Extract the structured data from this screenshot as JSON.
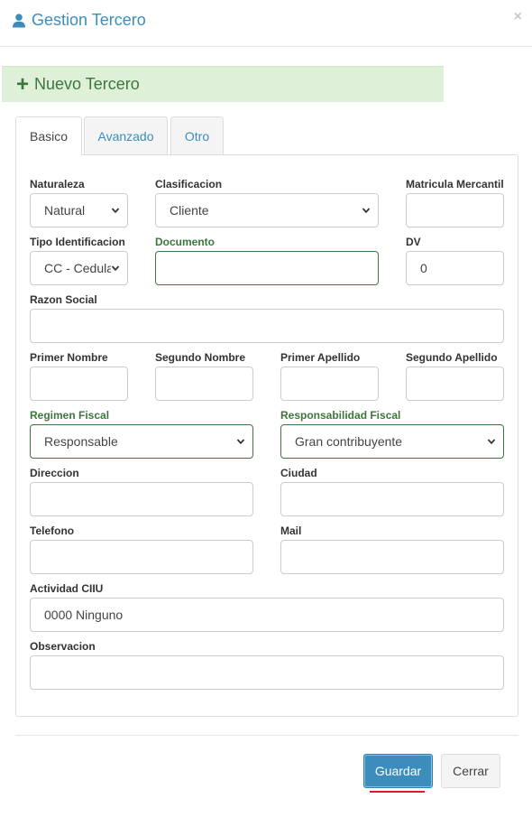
{
  "header": {
    "title": "Gestion Tercero",
    "close": "×"
  },
  "banner": {
    "label": "Nuevo Tercero"
  },
  "tabs": [
    {
      "label": "Basico",
      "active": true
    },
    {
      "label": "Avanzado",
      "active": false
    },
    {
      "label": "Otro",
      "active": false
    }
  ],
  "form": {
    "naturaleza": {
      "label": "Naturaleza",
      "value": "Natural"
    },
    "clasificacion": {
      "label": "Clasificacion",
      "value": "Cliente"
    },
    "matricula": {
      "label": "Matricula Mercantil",
      "value": ""
    },
    "tipo_id": {
      "label": "Tipo Identificacion",
      "value": "CC - Cedula"
    },
    "documento": {
      "label": "Documento",
      "value": ""
    },
    "dv": {
      "label": "DV",
      "value": "0"
    },
    "razon_social": {
      "label": "Razon Social",
      "value": ""
    },
    "primer_nombre": {
      "label": "Primer Nombre",
      "value": ""
    },
    "segundo_nombre": {
      "label": "Segundo Nombre",
      "value": ""
    },
    "primer_apellido": {
      "label": "Primer Apellido",
      "value": ""
    },
    "segundo_apellido": {
      "label": "Segundo Apellido",
      "value": ""
    },
    "regimen_fiscal": {
      "label": "Regimen Fiscal",
      "value": "Responsable"
    },
    "responsabilidad_fiscal": {
      "label": "Responsabilidad Fiscal",
      "value": "Gran contribuyente"
    },
    "direccion": {
      "label": "Direccion",
      "value": ""
    },
    "ciudad": {
      "label": "Ciudad",
      "value": ""
    },
    "telefono": {
      "label": "Telefono",
      "value": ""
    },
    "mail": {
      "label": "Mail",
      "value": ""
    },
    "actividad_ciiu": {
      "label": "Actividad CIIU",
      "value": "0000 Ninguno"
    },
    "observacion": {
      "label": "Observacion",
      "value": ""
    }
  },
  "buttons": {
    "save": "Guardar",
    "close": "Cerrar"
  },
  "colors": {
    "accent": "#3c8dbc",
    "success": "#3c763d",
    "banner_bg": "#dff0d8",
    "underline": "#e0182c"
  }
}
